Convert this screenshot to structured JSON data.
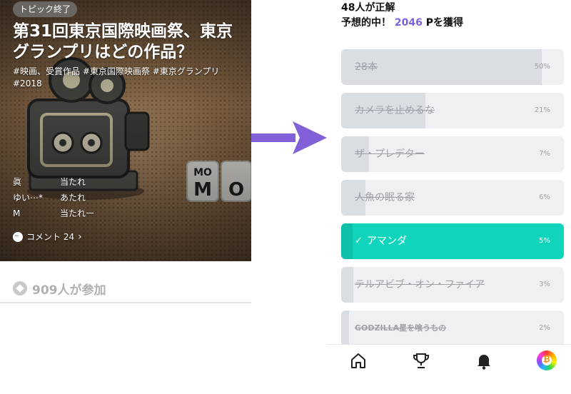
{
  "topic": {
    "status_badge": "トピック終了",
    "title": "第31回東京国際映画祭、東京グランプリはどの作品？",
    "tags": "#映画、受賞作品 #東京国際映画祭 #東京グランプリ #2018",
    "results": [
      {
        "user": "眞",
        "result": "当たれ"
      },
      {
        "user": "ゆい⋯*",
        "result": "あたれ"
      },
      {
        "user": "M",
        "result": "当たれー"
      }
    ],
    "comment_label": "コメント 24",
    "participants": "909人が参加"
  },
  "summary": {
    "correct_count": "48人が正解",
    "prediction_prefix": "予想的中！",
    "points": "2046",
    "prediction_suffix": " Pを獲得"
  },
  "options": [
    {
      "label": "28本",
      "percent_label": "50%",
      "percent": 50,
      "correct": false
    },
    {
      "label": "カメラを止めるな",
      "percent_label": "21%",
      "percent": 21,
      "correct": false
    },
    {
      "label": "ザ・プレデター",
      "percent_label": "7%",
      "percent": 7,
      "correct": false
    },
    {
      "label": "人魚の眠る家",
      "percent_label": "6%",
      "percent": 6,
      "correct": false
    },
    {
      "label": "アマンダ",
      "percent_label": "5%",
      "percent": 5,
      "correct": true
    },
    {
      "label": "テルアビブ・オン・ファイア",
      "percent_label": "3%",
      "percent": 3,
      "correct": false
    },
    {
      "label": "GODZILLA星を喰うもの",
      "percent_label": "2%",
      "percent": 2,
      "correct": false
    }
  ],
  "nav": [
    "home-icon",
    "trophy-icon",
    "bell-icon",
    "avatar"
  ],
  "colors": {
    "accent_purple": "#7b62d9",
    "correct_teal": "#10d5bc",
    "arrow": "#8160d8"
  }
}
